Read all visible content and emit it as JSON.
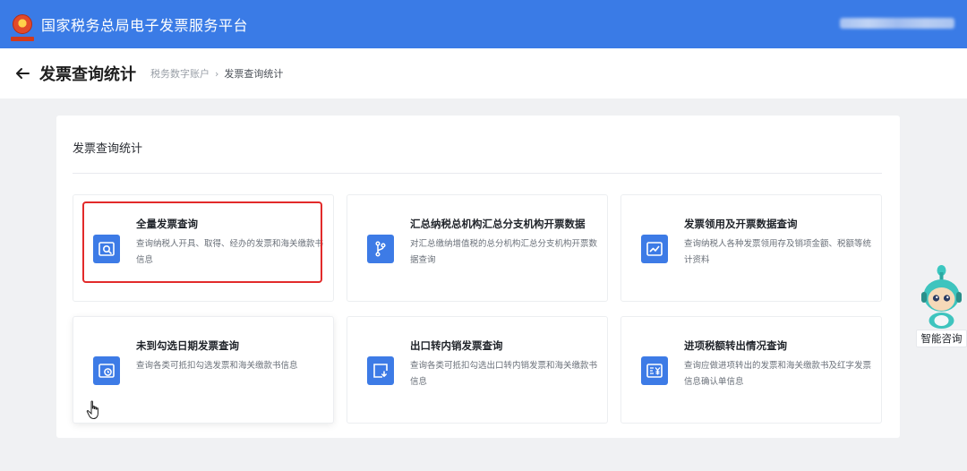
{
  "header": {
    "platform_title": "国家税务总局电子发票服务平台",
    "brand_color": "#3a7be6"
  },
  "subbar": {
    "page_title": "发票查询统计",
    "breadcrumb": {
      "parent": "税务数字账户",
      "separator": "›",
      "current": "发票查询统计"
    }
  },
  "panel": {
    "title": "发票查询统计",
    "cards": [
      {
        "title": "全量发票查询",
        "desc": "查询纳税人开具、取得、经办的发票和海关缴款书信息",
        "icon": "invoice-search-icon"
      },
      {
        "title": "汇总纳税总机构汇总分支机构开票数据",
        "desc": "对汇总缴纳增值税的总分机构汇总分支机构开票数据查询",
        "icon": "branch-icon"
      },
      {
        "title": "发票领用及开票数据查询",
        "desc": "查询纳税人各种发票领用存及销项金额、税额等统计资料",
        "icon": "chart-trend-icon"
      },
      {
        "title": "未到勾选日期发票查询",
        "desc": "查询各类可抵扣勾选发票和海关缴款书信息",
        "icon": "clock-invoice-icon"
      },
      {
        "title": "出口转内销发票查询",
        "desc": "查询各类可抵扣勾选出口转内销发票和海关缴款书信息",
        "icon": "export-domestic-icon"
      },
      {
        "title": "进项税额转出情况查询",
        "desc": "查询应做进项转出的发票和海关缴款书及红字发票信息确认单信息",
        "icon": "yuan-invoice-icon"
      }
    ]
  },
  "assistant": {
    "label": "智能咨询"
  },
  "colors": {
    "accent": "#3d7be6",
    "highlight": "#e22a2a"
  }
}
